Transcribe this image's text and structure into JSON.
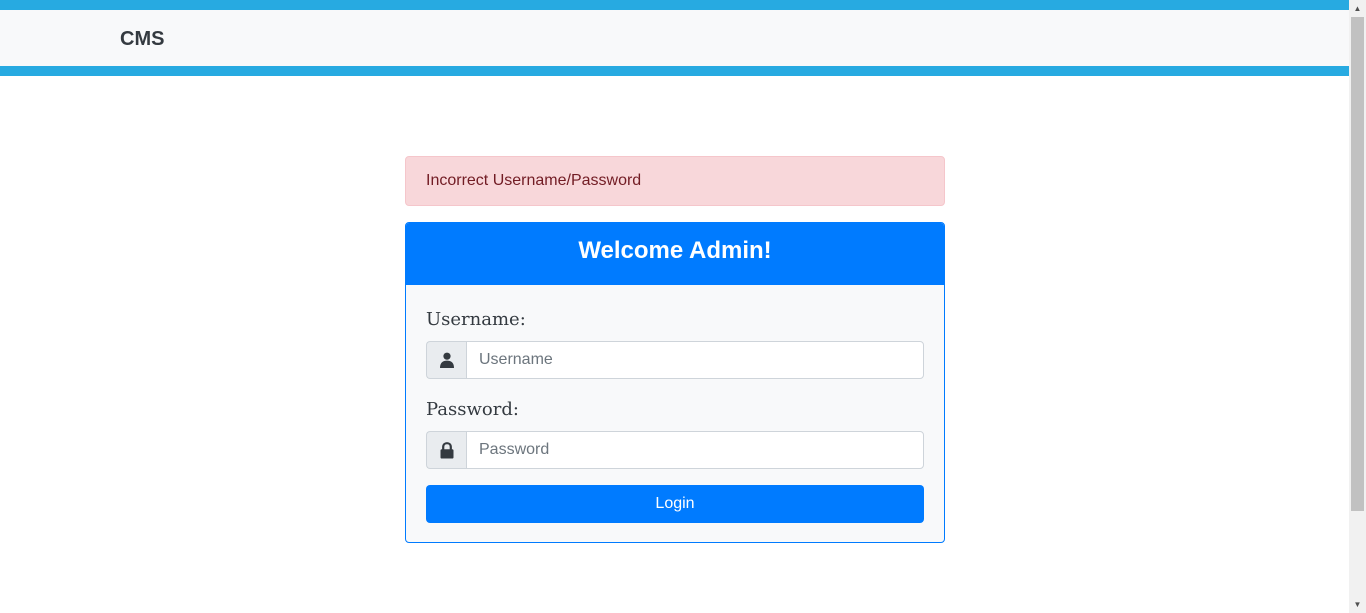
{
  "navbar": {
    "brand": "CMS",
    "stripe_color": "#27aae1"
  },
  "alert": {
    "message": "Incorrect Username/Password",
    "type": "danger"
  },
  "login_card": {
    "title": "Welcome Admin!",
    "username": {
      "label": "Username:",
      "placeholder": "Username",
      "icon": "user-icon",
      "value": ""
    },
    "password": {
      "label": "Password:",
      "placeholder": "Password",
      "icon": "lock-icon",
      "value": ""
    },
    "submit_label": "Login",
    "accent_color": "#007bff"
  }
}
